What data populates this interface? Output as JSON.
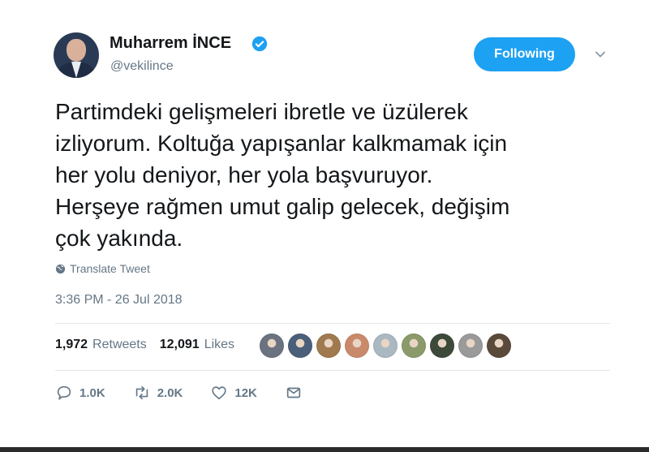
{
  "header": {
    "display_name": "Muharrem İNCE",
    "handle": "@vekilince",
    "verified_icon": "verified-badge-icon",
    "follow_button_label": "Following",
    "caret_icon": "chevron-down-icon"
  },
  "tweet": {
    "text": "Partimdeki gelişmeleri ibretle ve üzülerek\nizliyorum. Koltuğa yapışanlar kalkmamak için\nher yolu deniyor, her yola başvuruyor.\nHerşeye rağmen umut galip gelecek, değişim\nçok yakında.",
    "translate_label": "Translate Tweet",
    "timestamp": "3:36 PM - 26 Jul 2018"
  },
  "stats": {
    "retweets_count": "1,972",
    "retweets_label": "Retweets",
    "likes_count": "12,091",
    "likes_label": "Likes",
    "liker_avatars": [
      {
        "color": "#6b7280"
      },
      {
        "color": "#4b5f7a"
      },
      {
        "color": "#a07a4e"
      },
      {
        "color": "#c98a6b"
      },
      {
        "color": "#aab8c2"
      },
      {
        "color": "#8a9a6a"
      },
      {
        "color": "#3d4a3a"
      },
      {
        "color": "#9a9a9a"
      },
      {
        "color": "#5a4a3a"
      }
    ]
  },
  "actions": {
    "reply_count": "1.0K",
    "retweet_count": "2.0K",
    "like_count": "12K"
  },
  "colors": {
    "accent": "#1da1f2",
    "secondary_text": "#657786",
    "divider": "#e1e8ed"
  }
}
